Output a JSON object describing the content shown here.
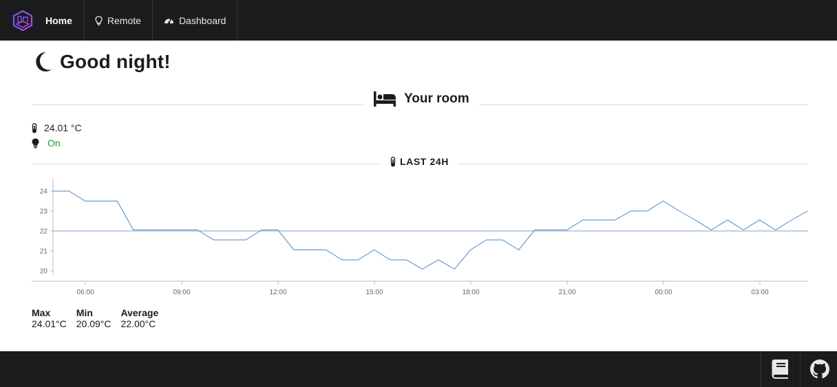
{
  "nav": {
    "home": "Home",
    "remote": "Remote",
    "dashboard": "Dashboard"
  },
  "greeting": "Good night!",
  "room": {
    "title": "Your room",
    "temperature": "24.01 °C",
    "light_status": "On"
  },
  "history_label": "LAST 24H",
  "stats": {
    "max_label": "Max",
    "max_value": "24.01°C",
    "min_label": "Min",
    "min_value": "20.09°C",
    "avg_label": "Average",
    "avg_value": "22.00°C"
  },
  "colors": {
    "topbar": "#1b1c1d",
    "line": "#4a86c5",
    "on_status": "#1e9b32"
  },
  "chart_data": {
    "type": "line",
    "x_ticks": [
      "06:00",
      "09:00",
      "12:00",
      "15:00",
      "18:00",
      "21:00",
      "00:00",
      "03:00"
    ],
    "y_ticks": [
      20,
      21,
      22,
      23,
      24
    ],
    "ylim": [
      19.5,
      24.5
    ],
    "x": [
      "05:00",
      "05:30",
      "06:00",
      "06:30",
      "07:00",
      "07:30",
      "08:00",
      "08:30",
      "09:00",
      "09:30",
      "10:00",
      "10:30",
      "11:00",
      "11:30",
      "12:00",
      "12:30",
      "13:00",
      "13:30",
      "14:00",
      "14:30",
      "15:00",
      "15:30",
      "16:00",
      "16:30",
      "17:00",
      "17:30",
      "18:00",
      "18:30",
      "19:00",
      "19:30",
      "20:00",
      "20:30",
      "21:00",
      "21:30",
      "22:00",
      "22:30",
      "23:00",
      "23:30",
      "00:00",
      "00:30",
      "01:00",
      "01:30",
      "02:00",
      "02:30",
      "03:00",
      "03:30",
      "04:00",
      "04:30"
    ],
    "values": [
      24.0,
      24.0,
      23.5,
      23.5,
      23.5,
      22.05,
      22.05,
      22.05,
      22.05,
      22.05,
      21.55,
      21.55,
      21.55,
      22.05,
      22.05,
      21.05,
      21.05,
      21.05,
      20.55,
      20.55,
      21.05,
      20.55,
      20.55,
      20.09,
      20.55,
      20.09,
      21.05,
      21.55,
      21.55,
      21.05,
      22.05,
      22.05,
      22.05,
      22.55,
      22.55,
      22.55,
      23.0,
      23.0,
      23.5,
      23.0,
      22.55,
      22.05,
      22.55,
      22.05,
      22.55,
      22.05,
      22.55,
      23.0
    ],
    "average": 22.0,
    "grid": false
  }
}
